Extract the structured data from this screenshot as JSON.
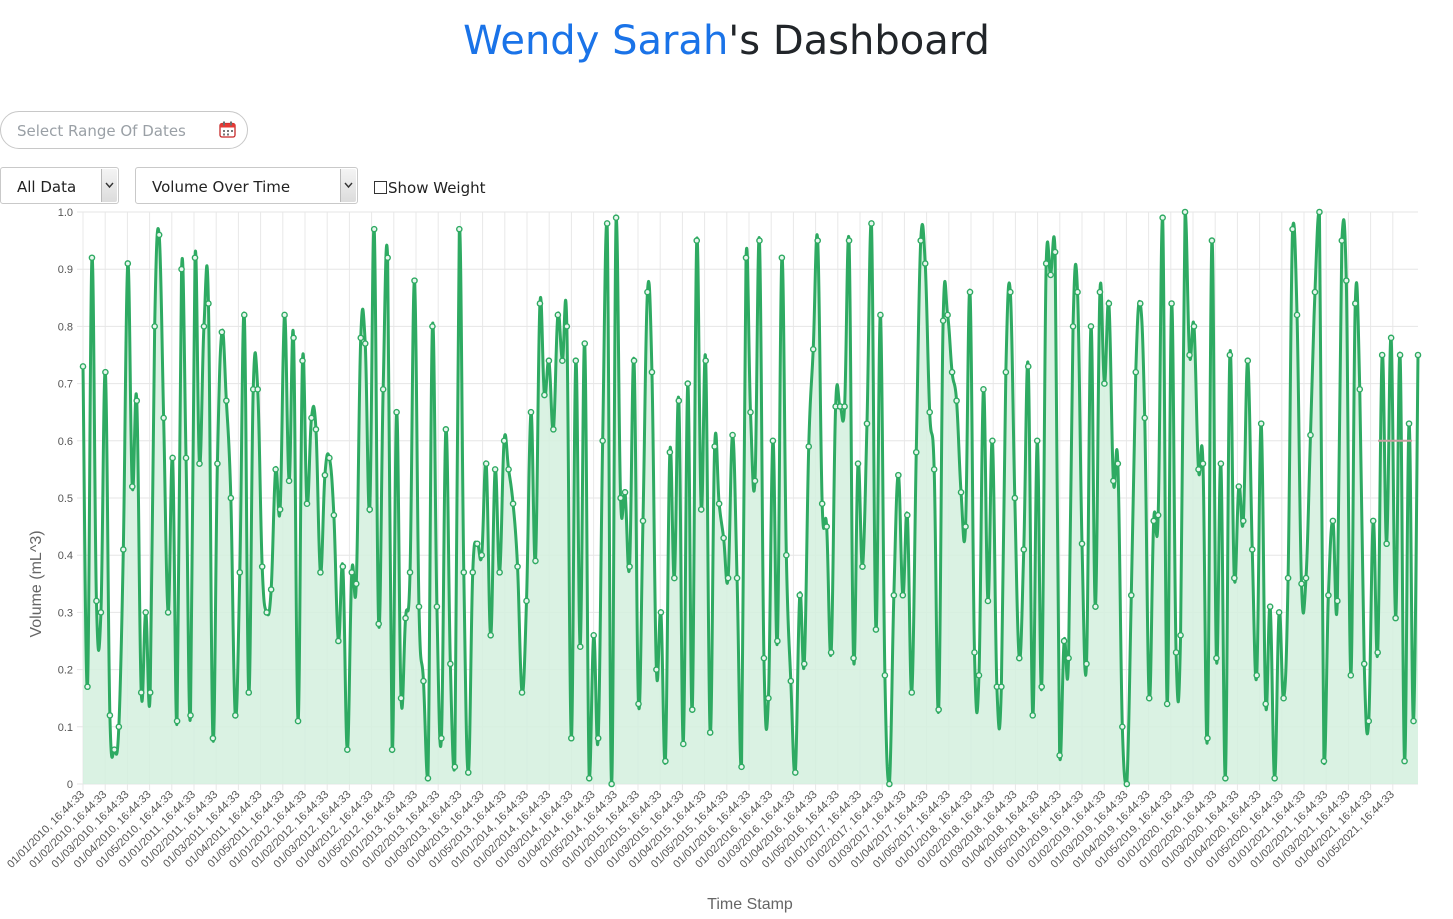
{
  "header": {
    "title_name": "Wendy Sarah",
    "title_suffix": "'s Dashboard"
  },
  "controls": {
    "date_range_placeholder": "Select Range Of Dates",
    "data_filter": {
      "selected": "All Data"
    },
    "chart_select": {
      "selected": "Volume Over Time"
    },
    "show_weight": {
      "label": "Show Weight",
      "checked": false
    }
  },
  "colors": {
    "accent": "#1a73e8",
    "series": "#2eaa62",
    "fill": "#d4f0de",
    "weight": "#c8a0a0"
  },
  "icons": {
    "calendar": "calendar-icon",
    "dropdown": "chevron-down-icon"
  },
  "chart_data": {
    "type": "area",
    "title": "",
    "xlabel": "Time Stamp",
    "ylabel": "Volume (mL^3)",
    "ylim": [
      0,
      1
    ],
    "yticks": [
      "0",
      "0.1",
      "0.2",
      "0.3",
      "0.4",
      "0.5",
      "0.6",
      "0.7",
      "0.8",
      "0.9",
      "1.0"
    ],
    "grid": true,
    "legend": "none",
    "x_start": "01/01/2010, 16:44:33",
    "x_end": "01/05/2021, 16:44:33",
    "x_ticks": [
      "01/01/2010, 16:44:33",
      "01/02/2010, 16:44:33",
      "01/03/2010, 16:44:33",
      "01/04/2010, 16:44:33",
      "01/05/2010, 16:44:33",
      "01/01/2011, 16:44:33",
      "01/02/2011, 16:44:33",
      "01/03/2011, 16:44:33",
      "01/04/2011, 16:44:33",
      "01/05/2011, 16:44:33",
      "01/01/2012, 16:44:33",
      "01/02/2012, 16:44:33",
      "01/03/2012, 16:44:33",
      "01/04/2012, 16:44:33",
      "01/05/2012, 16:44:33",
      "01/01/2013, 16:44:33",
      "01/02/2013, 16:44:33",
      "01/03/2013, 16:44:33",
      "01/04/2013, 16:44:33",
      "01/05/2013, 16:44:33",
      "01/01/2014, 16:44:33",
      "01/02/2014, 16:44:33",
      "01/03/2014, 16:44:33",
      "01/04/2014, 16:44:33",
      "01/05/2014, 16:44:33",
      "01/01/2015, 16:44:33",
      "01/02/2015, 16:44:33",
      "01/03/2015, 16:44:33",
      "01/04/2015, 16:44:33",
      "01/05/2015, 16:44:33",
      "01/01/2016, 16:44:33",
      "01/02/2016, 16:44:33",
      "01/03/2016, 16:44:33",
      "01/04/2016, 16:44:33",
      "01/05/2016, 16:44:33",
      "01/01/2017, 16:44:33",
      "01/02/2017, 16:44:33",
      "01/03/2017, 16:44:33",
      "01/04/2017, 16:44:33",
      "01/05/2017, 16:44:33",
      "01/01/2018, 16:44:33",
      "01/02/2018, 16:44:33",
      "01/03/2018, 16:44:33",
      "01/04/2018, 16:44:33",
      "01/05/2018, 16:44:33",
      "01/01/2019, 16:44:33",
      "01/02/2019, 16:44:33",
      "01/03/2019, 16:44:33",
      "01/04/2019, 16:44:33",
      "01/05/2019, 16:44:33",
      "01/01/2020, 16:44:33",
      "01/02/2020, 16:44:33",
      "01/03/2020, 16:44:33",
      "01/04/2020, 16:44:33",
      "01/05/2020, 16:44:33",
      "01/01/2021, 16:44:33",
      "01/02/2021, 16:44:33",
      "01/03/2021, 16:44:33",
      "01/04/2021, 16:44:33",
      "01/05/2021, 16:44:33"
    ],
    "series": [
      {
        "values": [
          0.73,
          0.17,
          0.92,
          0.32,
          0.3,
          0.72,
          0.12,
          0.06,
          0.1,
          0.41,
          0.91,
          0.52,
          0.67,
          0.16,
          0.3,
          0.16,
          0.8,
          0.96,
          0.64,
          0.3,
          0.57,
          0.11,
          0.9,
          0.57,
          0.12,
          0.92,
          0.56,
          0.8,
          0.84,
          0.08,
          0.56,
          0.79,
          0.67,
          0.5,
          0.12,
          0.37,
          0.82,
          0.16,
          0.69,
          0.69,
          0.38,
          0.3,
          0.34,
          0.55,
          0.48,
          0.82,
          0.53,
          0.78,
          0.11,
          0.74,
          0.49,
          0.64,
          0.62,
          0.37,
          0.54,
          0.57,
          0.47,
          0.25,
          0.38,
          0.06,
          0.37,
          0.35,
          0.78,
          0.77,
          0.48,
          0.97,
          0.28,
          0.69,
          0.92,
          0.06,
          0.65,
          0.15,
          0.29,
          0.37,
          0.88,
          0.31,
          0.18,
          0.01,
          0.8,
          0.31,
          0.08,
          0.62,
          0.21,
          0.03,
          0.97,
          0.37,
          0.02,
          0.37,
          0.42,
          0.4,
          0.56,
          0.26,
          0.55,
          0.37,
          0.6,
          0.55,
          0.49,
          0.38,
          0.16,
          0.32,
          0.65,
          0.39,
          0.84,
          0.68,
          0.74,
          0.62,
          0.82,
          0.74,
          0.8,
          0.08,
          0.74,
          0.24,
          0.77,
          0.01,
          0.26,
          0.08,
          0.6,
          0.98,
          0.0,
          0.99,
          0.5,
          0.51,
          0.38,
          0.74,
          0.14,
          0.46,
          0.86,
          0.72,
          0.2,
          0.3,
          0.04,
          0.58,
          0.36,
          0.67,
          0.07,
          0.7,
          0.13,
          0.95,
          0.48,
          0.74,
          0.09,
          0.59,
          0.49,
          0.43,
          0.36,
          0.61,
          0.36,
          0.03,
          0.92,
          0.65,
          0.53,
          0.95,
          0.22,
          0.15,
          0.6,
          0.25,
          0.92,
          0.4,
          0.18,
          0.02,
          0.33,
          0.21,
          0.59,
          0.76,
          0.95,
          0.49,
          0.45,
          0.23,
          0.66,
          0.66,
          0.66,
          0.95,
          0.22,
          0.56,
          0.38,
          0.63,
          0.98,
          0.27,
          0.82,
          0.19,
          0.0,
          0.33,
          0.54,
          0.33,
          0.47,
          0.16,
          0.58,
          0.95,
          0.91,
          0.65,
          0.55,
          0.13,
          0.81,
          0.82,
          0.72,
          0.67,
          0.51,
          0.45,
          0.86,
          0.23,
          0.19,
          0.69,
          0.32,
          0.6,
          0.17,
          0.17,
          0.72,
          0.86,
          0.5,
          0.22,
          0.41,
          0.73,
          0.12,
          0.6,
          0.17,
          0.91,
          0.89,
          0.93,
          0.05,
          0.25,
          0.22,
          0.8,
          0.86,
          0.42,
          0.21,
          0.8,
          0.31,
          0.86,
          0.7,
          0.84,
          0.53,
          0.56,
          0.1,
          0.0,
          0.33,
          0.72,
          0.84,
          0.64,
          0.15,
          0.46,
          0.47,
          0.99,
          0.14,
          0.84,
          0.23,
          0.26,
          1.0,
          0.75,
          0.8,
          0.55,
          0.56,
          0.08,
          0.95,
          0.22,
          0.56,
          0.01,
          0.75,
          0.36,
          0.52,
          0.46,
          0.74,
          0.41,
          0.19,
          0.63,
          0.14,
          0.31,
          0.01,
          0.3,
          0.15,
          0.36,
          0.97,
          0.82,
          0.35,
          0.36,
          0.61,
          0.86,
          1.0,
          0.04,
          0.33,
          0.46,
          0.32,
          0.95,
          0.88,
          0.19,
          0.84,
          0.69,
          0.21,
          0.11,
          0.46,
          0.23,
          0.75,
          0.42,
          0.78,
          0.29,
          0.75,
          0.04,
          0.63,
          0.11,
          0.75
        ]
      }
    ],
    "weight_values": [
      0.6,
      0.6,
      0.6,
      0.6
    ]
  }
}
